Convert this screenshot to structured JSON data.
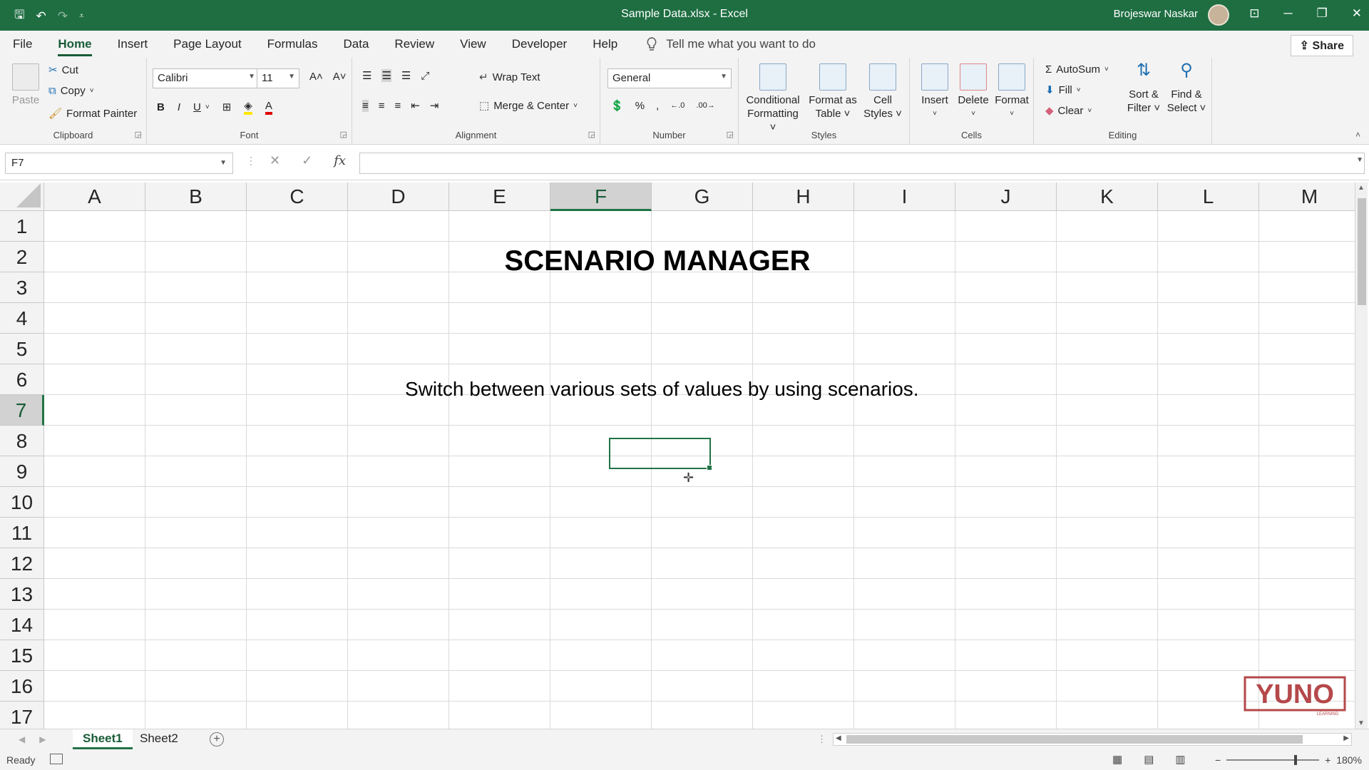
{
  "window": {
    "title": "Sample Data.xlsx  -  Excel",
    "user": "Brojeswar Naskar",
    "qat": {
      "save": "🖫",
      "undo": "↶",
      "redo": "↷",
      "customize": "⩡"
    },
    "controls": {
      "ribbon_display": "⊡",
      "minimize": "─",
      "restore": "❐",
      "close": "✕"
    }
  },
  "menu": {
    "tabs": [
      "File",
      "Home",
      "Insert",
      "Page Layout",
      "Formulas",
      "Data",
      "Review",
      "View",
      "Developer",
      "Help"
    ],
    "tell_me": "Tell me what you want to do",
    "share": "Share"
  },
  "ribbon": {
    "clipboard": {
      "label": "Clipboard",
      "paste": "Paste",
      "cut": "Cut",
      "copy": "Copy",
      "format_painter": "Format Painter"
    },
    "font": {
      "label": "Font",
      "name": "Calibri",
      "size": "11",
      "bold": "B",
      "italic": "I",
      "underline": "U",
      "grow": "A˄",
      "shrink": "A˅"
    },
    "alignment": {
      "label": "Alignment",
      "wrap_text": "Wrap Text",
      "merge_center": "Merge & Center"
    },
    "number": {
      "label": "Number",
      "format": "General",
      "percent": "%",
      "comma": ",",
      "increase_decimal": "←.0",
      "decrease_decimal": ".00→"
    },
    "styles": {
      "label": "Styles",
      "conditional": [
        "Conditional",
        "Formatting ˅"
      ],
      "format_table": [
        "Format as",
        "Table ˅"
      ],
      "cell_styles": [
        "Cell",
        "Styles ˅"
      ]
    },
    "cells": {
      "label": "Cells",
      "insert": "Insert",
      "delete": "Delete",
      "format": "Format"
    },
    "editing": {
      "label": "Editing",
      "autosum": "AutoSum",
      "fill": "Fill",
      "clear": "Clear",
      "sort_filter": [
        "Sort &",
        "Filter ˅"
      ],
      "find_select": [
        "Find &",
        "Select ˅"
      ]
    }
  },
  "formula_bar": {
    "name_box": "F7",
    "cancel": "✕",
    "enter": "✓",
    "fx": "fx",
    "formula": ""
  },
  "sheet": {
    "columns": [
      "A",
      "B",
      "C",
      "D",
      "E",
      "F",
      "G",
      "H",
      "I",
      "J",
      "K",
      "L",
      "M"
    ],
    "rows": [
      "1",
      "2",
      "3",
      "4",
      "5",
      "6",
      "7",
      "8",
      "9",
      "10",
      "11",
      "12",
      "13",
      "14",
      "15",
      "16",
      "17"
    ],
    "selected_column": "F",
    "selected_row": "7",
    "cells": {
      "title": "SCENARIO MANAGER",
      "subtitle": "Switch between various sets of values by using scenarios."
    }
  },
  "sheet_tabs": [
    "Sheet1",
    "Sheet2"
  ],
  "status": {
    "ready": "Ready",
    "zoom": "180%"
  },
  "watermark": {
    "text": "YUNO",
    "sub": "LEARNING",
    "color": "#b5484a"
  }
}
